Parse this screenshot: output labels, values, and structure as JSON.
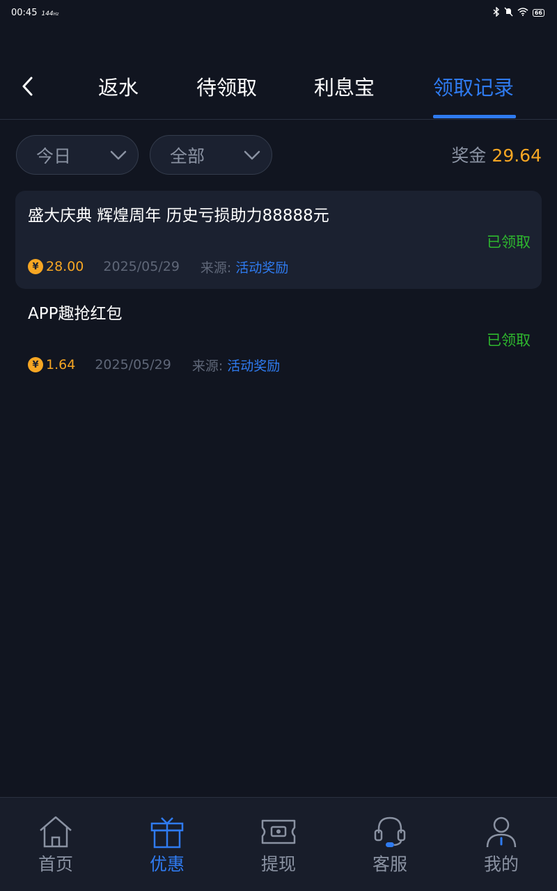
{
  "status_bar": {
    "time": "00:45",
    "refresh_rate": "144",
    "refresh_unit": "Hz",
    "battery": "66"
  },
  "header": {
    "tabs": [
      {
        "label": "返水",
        "active": false
      },
      {
        "label": "待领取",
        "active": false
      },
      {
        "label": "利息宝",
        "active": false
      },
      {
        "label": "领取记录",
        "active": true
      }
    ]
  },
  "filters": {
    "period": "今日",
    "category": "全部"
  },
  "bonus": {
    "label": "奖金",
    "value": "29.64"
  },
  "records": [
    {
      "title": "盛大庆典 辉煌周年 历史亏损助力88888元",
      "status": "已领取",
      "amount": "28.00",
      "date": "2025/05/29",
      "source_label": "来源:",
      "source_value": "活动奖励"
    },
    {
      "title": "APP趣抢红包",
      "status": "已领取",
      "amount": "1.64",
      "date": "2025/05/29",
      "source_label": "来源:",
      "source_value": "活动奖励"
    }
  ],
  "currency_symbol": "¥",
  "bottom_nav": [
    {
      "label": "首页",
      "icon": "home-icon",
      "active": false
    },
    {
      "label": "优惠",
      "icon": "gift-icon",
      "active": true
    },
    {
      "label": "提现",
      "icon": "ticket-icon",
      "active": false
    },
    {
      "label": "客服",
      "icon": "headset-icon",
      "active": false
    },
    {
      "label": "我的",
      "icon": "user-icon",
      "active": false
    }
  ],
  "colors": {
    "accent": "#2f7bf0",
    "gold": "#f6a623",
    "success": "#2eb82e",
    "background": "#111520"
  }
}
